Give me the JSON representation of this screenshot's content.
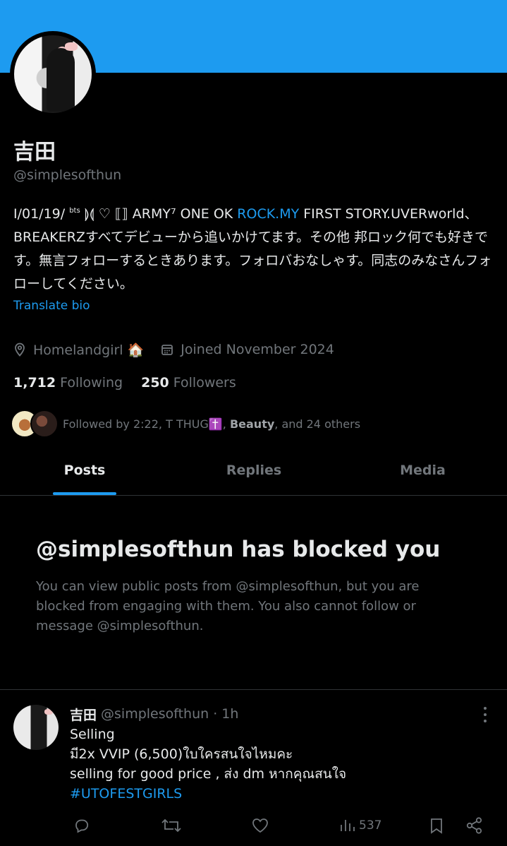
{
  "profile": {
    "display_name": "吉田",
    "handle": "@simplesofthun",
    "bio": {
      "part1": "I/01/19/ ",
      "sup": "bts",
      "part2": " ⟭⟬ ♡ ⟦⟧ ARMY⁷ ONE OK ",
      "link": "ROCK.MY",
      "part3": " FIRST STORY.UVERworld、BREAKERZすべてデビューから追いかけてます。その他 邦ロック何でも好きです。無言フォローするときあります。フォロバおなしゃす。同志のみなさんフォローしてください。"
    },
    "translate_label": "Translate bio",
    "location": "Homelandgirl 🏠",
    "joined": "Joined November 2024",
    "following_count": "1,712",
    "following_label": "Following",
    "followers_count": "250",
    "followers_label": "Followers",
    "followed_by": {
      "prefix": "Followed by 2:22, T THUG✝️, ",
      "bold": "Beauty",
      "suffix": ", and 24 others"
    }
  },
  "tabs": [
    {
      "label": "Posts",
      "active": true
    },
    {
      "label": "Replies",
      "active": false
    },
    {
      "label": "Media",
      "active": false
    }
  ],
  "blocked": {
    "title": "@simplesofthun has blocked you",
    "description": "You can view public posts from @simplesofthun, but you are blocked from engaging with them. You also cannot follow or message @simplesofthun."
  },
  "tweet": {
    "name": "吉田",
    "handle_time": "@simplesofthun · 1h",
    "lines": [
      "Selling",
      "มี2x VVIP (6,500)ใบใครสนใจไหมคะ",
      "selling for good price , ส่ง dm หากคุณสนใจ"
    ],
    "hashtag": "#UTOFESTGIRLS",
    "views": "537"
  },
  "icons": {
    "location": "location-pin-icon",
    "calendar": "calendar-icon",
    "reply": "reply-icon",
    "retweet": "retweet-icon",
    "like": "heart-icon",
    "views": "views-chart-icon",
    "bookmark": "bookmark-icon",
    "share": "share-icon",
    "more": "more-vertical-icon"
  },
  "colors": {
    "accent": "#1d9bf0",
    "background": "#000000",
    "muted": "#71767b"
  }
}
